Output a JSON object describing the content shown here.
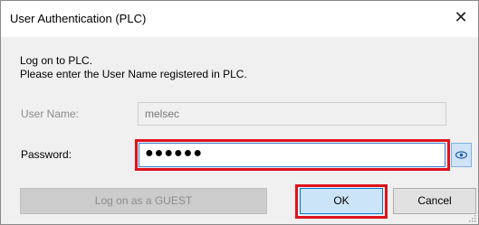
{
  "window": {
    "title": "User Authentication (PLC)"
  },
  "message": {
    "line1": "Log on to PLC.",
    "line2": "Please enter the User Name registered in PLC."
  },
  "username": {
    "label": "User Name:",
    "value": "melsec"
  },
  "password": {
    "label": "Password:",
    "value": "●●●●●●"
  },
  "buttons": {
    "guest": "Log on as a GUEST",
    "ok": "OK",
    "cancel": "Cancel"
  },
  "colors": {
    "highlight": "#e0121b",
    "focus": "#0078d7"
  },
  "icons": {
    "close": "close-icon",
    "show_password": "eye-icon"
  }
}
